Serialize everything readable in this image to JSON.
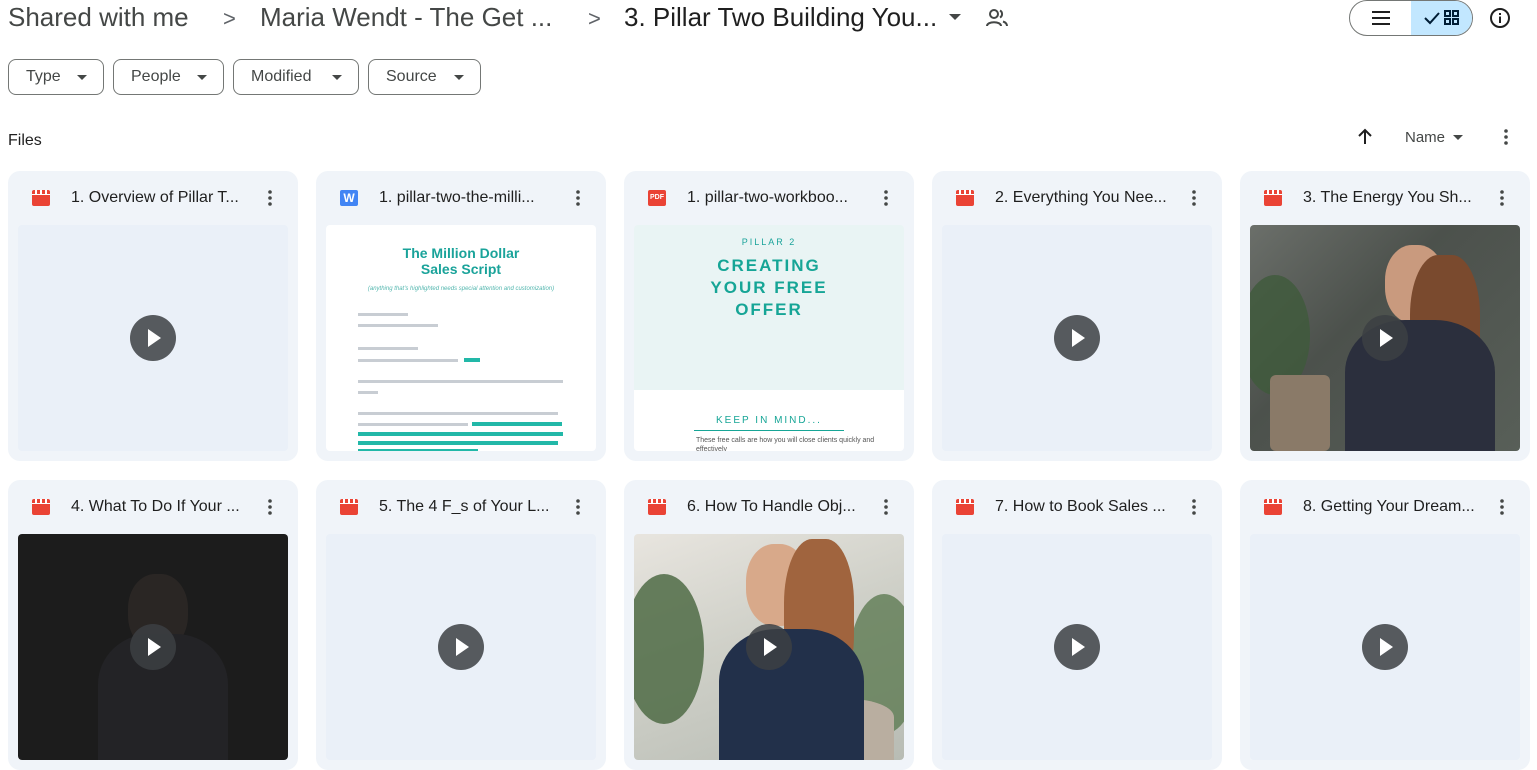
{
  "breadcrumb": {
    "items": [
      "Shared with me",
      "Maria Wendt - The Get ...",
      "3. Pillar Two Building You..."
    ],
    "separator": ">"
  },
  "icons": {
    "current_folder_dropdown": "chevron-down-icon",
    "shared_folder": "people-icon",
    "list_view": "list-icon",
    "grid_view": "grid-icon",
    "grid_selected": "checkmark-icon",
    "details": "info-icon",
    "sort_direction": "arrow-up-icon",
    "sort_menu": "chevron-down-icon",
    "more": "more-vert-icon",
    "play": "play-icon"
  },
  "filters": [
    "Type",
    "People",
    "Modified",
    "Source"
  ],
  "files_label": "Files",
  "sort": {
    "direction": "ascending",
    "label": "Name"
  },
  "colors": {
    "accent": "#c2e7ff",
    "card_bg": "#f0f4f9",
    "video_icon": "#ea4335",
    "word_icon": "#4285f4",
    "pdf_icon": "#ea4335"
  },
  "files": [
    {
      "name": "1. Overview of Pillar T...",
      "type": "video",
      "thumb": "blank"
    },
    {
      "name": "1. pillar-two-the-milli...",
      "type": "word",
      "type_label": "W",
      "thumb": "doc",
      "preview": {
        "title_line1": "The Million Dollar",
        "title_line2": "Sales Script",
        "subtitle": "(anything that's highlighted needs special attention and customization)"
      }
    },
    {
      "name": "1. pillar-two-workboo...",
      "type": "pdf",
      "type_label": "PDF",
      "thumb": "pdf",
      "preview": {
        "kicker": "PILLAR 2",
        "line1": "CREATING",
        "line2": "YOUR FREE",
        "line3": "OFFER",
        "keep": "KEEP IN MIND...",
        "bullet": "These free calls are how you will close clients quickly and effectively"
      }
    },
    {
      "name": "2. Everything You Nee...",
      "type": "video",
      "thumb": "blank"
    },
    {
      "name": "3. The Energy You Sh...",
      "type": "video",
      "thumb": "photo-lady"
    },
    {
      "name": "4. What To Do If Your ...",
      "type": "video",
      "thumb": "photo-dark"
    },
    {
      "name": "5. The 4 F_s of Your L...",
      "type": "video",
      "thumb": "blank"
    },
    {
      "name": "6. How To Handle Obj...",
      "type": "video",
      "thumb": "photo-bright"
    },
    {
      "name": "7. How to Book Sales ...",
      "type": "video",
      "thumb": "blank"
    },
    {
      "name": "8. Getting Your Dream...",
      "type": "video",
      "thumb": "blank"
    }
  ]
}
